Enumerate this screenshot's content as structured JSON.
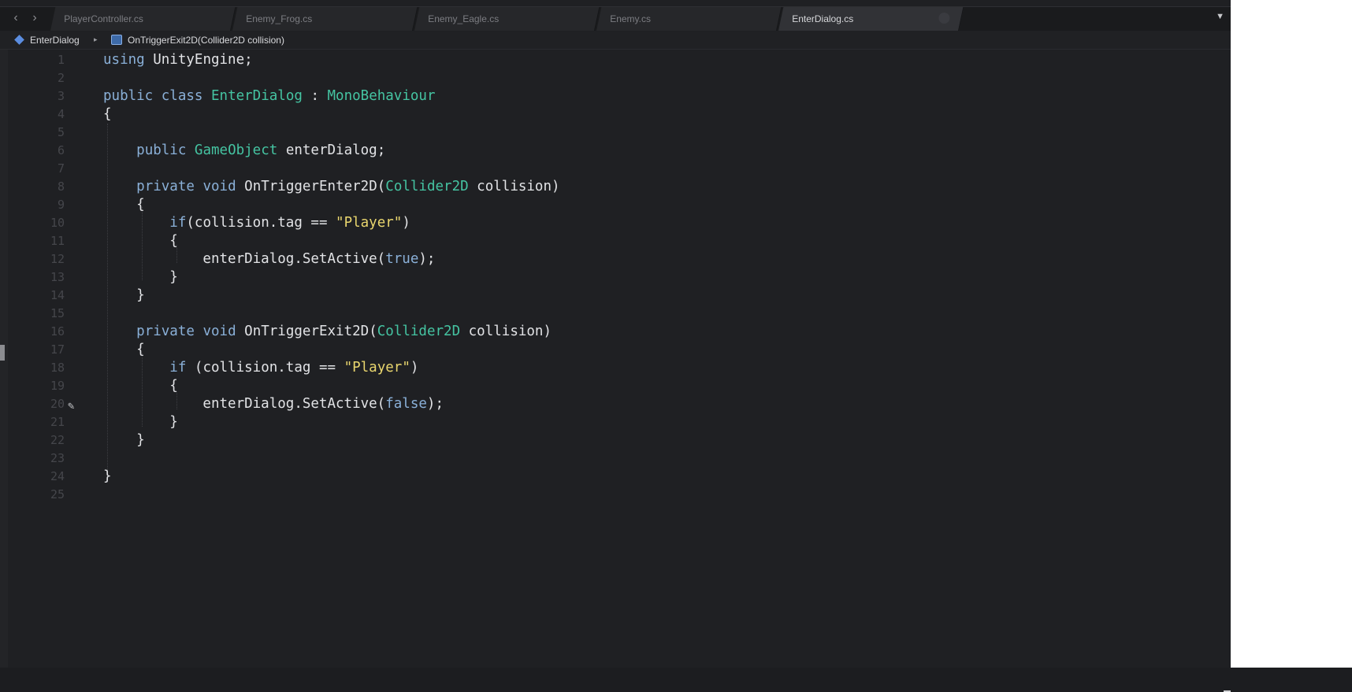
{
  "tabs": [
    {
      "label": "PlayerController.cs",
      "active": false
    },
    {
      "label": "Enemy_Frog.cs",
      "active": false
    },
    {
      "label": "Enemy_Eagle.cs",
      "active": false
    },
    {
      "label": "Enemy.cs",
      "active": false
    },
    {
      "label": "EnterDialog.cs",
      "active": true
    }
  ],
  "nav": {
    "back_icon": "chevron-left-icon",
    "forward_icon": "chevron-right-icon",
    "back": "‹",
    "forward": "›",
    "overflow": "▼"
  },
  "breadcrumb": {
    "class_name": "EnterDialog",
    "separator": "▸",
    "method_name": "OnTriggerExit2D(Collider2D collision)"
  },
  "editor": {
    "line_numbers": [
      "1",
      "2",
      "3",
      "4",
      "5",
      "6",
      "7",
      "8",
      "9",
      "10",
      "11",
      "12",
      "13",
      "14",
      "15",
      "16",
      "17",
      "18",
      "19",
      "20",
      "21",
      "22",
      "23",
      "24",
      "25"
    ],
    "edit_marker_line": "20",
    "edit_marker_icon": "pencil-icon",
    "colors": {
      "keyword": "#8ab0d8",
      "type": "#45c4a2",
      "string": "#e9d66e",
      "plain": "#e2e3e6"
    }
  }
}
